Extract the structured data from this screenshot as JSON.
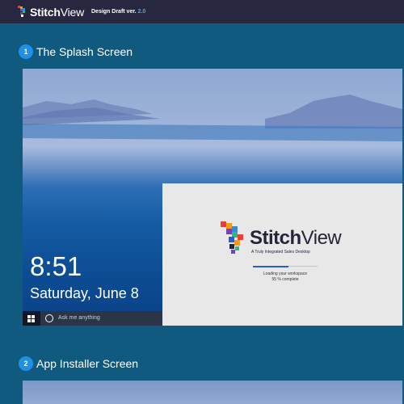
{
  "header": {
    "brand_bold": "Stitch",
    "brand_regular": "View",
    "draft_label": "Design Draft ver.",
    "draft_version": "2.0"
  },
  "sections": [
    {
      "number": "1",
      "title": "The Splash Screen"
    },
    {
      "number": "2",
      "title": "App Installer Screen"
    }
  ],
  "lockscreen": {
    "time": "8:51",
    "date": "Saturday, June 8"
  },
  "taskbar": {
    "search_placeholder": "Ask me anything",
    "icons": [
      "windows-start-icon",
      "cortana-icon",
      "microphone-icon",
      "task-view-icon",
      "edge-icon",
      "file-explorer-icon",
      "store-icon",
      "mail-icon"
    ]
  },
  "splash": {
    "brand_bold": "Stitch",
    "brand_regular": "View",
    "tagline": "A Truly Integrated Sales Desktop",
    "loading_text": "Loading your workspace",
    "progress_text": "55 % complete",
    "progress_value": 0.55
  },
  "colors": {
    "page_background": "#0f5a7e",
    "topbar": "#27273f",
    "badge": "#1e90e6",
    "version_accent": "#4aa7e8",
    "progress": "#2a5bd7",
    "taskbar": "#101827"
  }
}
